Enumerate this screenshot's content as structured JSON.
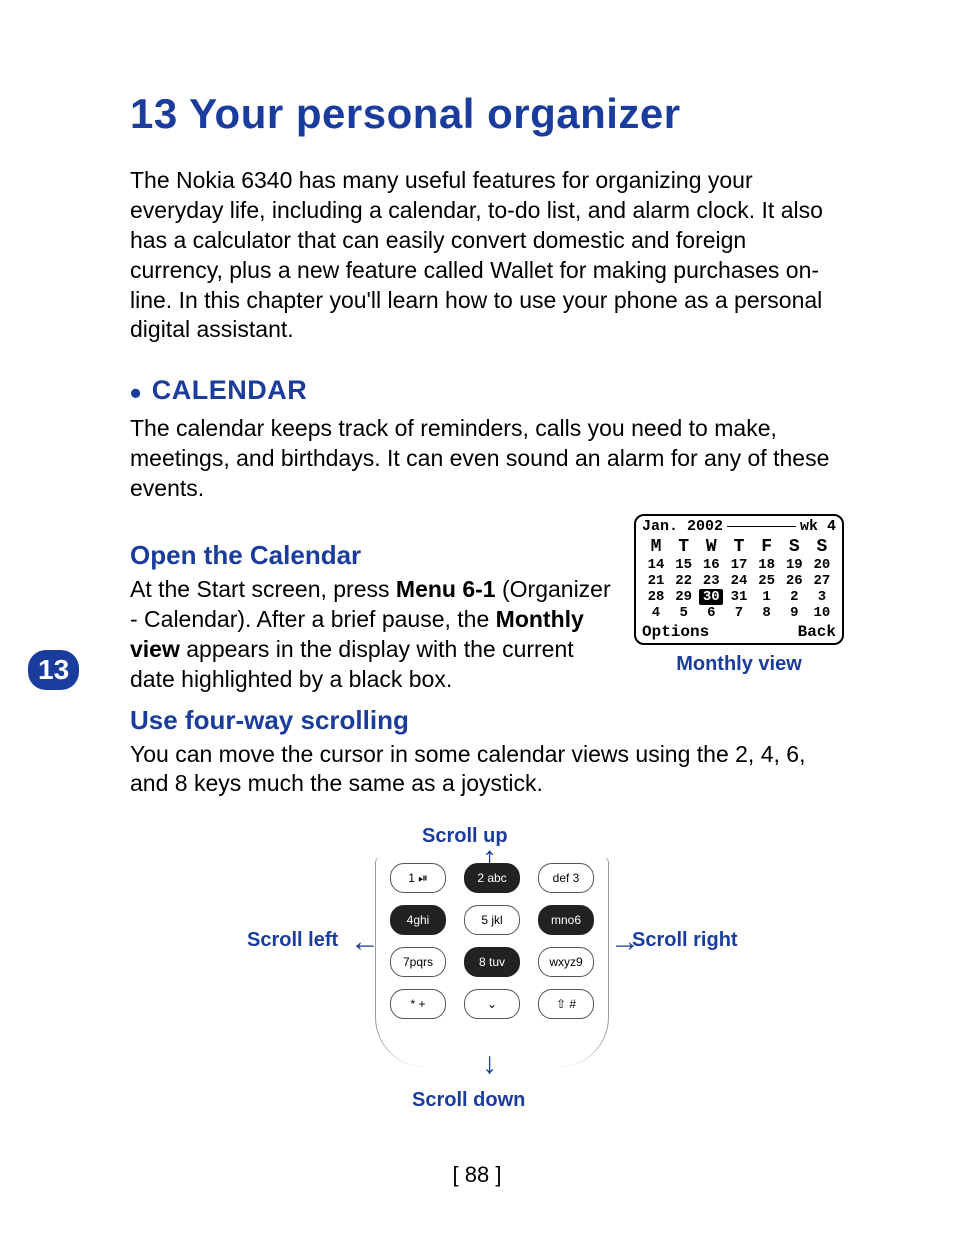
{
  "chapter": {
    "number": "13",
    "title": "Your personal organizer",
    "tab": "13"
  },
  "intro": "The Nokia 6340 has many useful features for organizing your everyday life, including a calendar, to-do list, and alarm clock. It also has a calculator that can easily convert domestic and foreign currency, plus a new feature called Wallet for making purchases on-line. In this chapter you'll learn how to use your phone as a personal digital assistant.",
  "section": {
    "heading": "CALENDAR",
    "text": "The calendar keeps track of reminders, calls you need to make, meetings, and birthdays. It can even sound an alarm for any of these events."
  },
  "open": {
    "heading": "Open the Calendar",
    "pre": "At the Start screen, press ",
    "menu": "Menu 6-1",
    "mid": " (Organizer - Calendar). After a brief pause, the ",
    "monthly": "Monthly view",
    "post": " appears in the display with the current date highlighted by a black box."
  },
  "calendar": {
    "month": "Jan. 2002",
    "week": "wk 4",
    "days": [
      "M",
      "T",
      "W",
      "T",
      "F",
      "S",
      "S"
    ],
    "rows": [
      [
        "14",
        "15",
        "16",
        "17",
        "18",
        "19",
        "20"
      ],
      [
        "21",
        "22",
        "23",
        "24",
        "25",
        "26",
        "27"
      ],
      [
        "28",
        "29",
        "30",
        "31",
        "1",
        "2",
        "3"
      ],
      [
        "4",
        "5",
        "6",
        "7",
        "8",
        "9",
        "10"
      ]
    ],
    "selected": "30",
    "left": "Options",
    "right": "Back",
    "caption": "Monthly view"
  },
  "scroll": {
    "heading": "Use four-way scrolling",
    "text": "You can move the cursor in some calendar views using the 2, 4, 6, and 8 keys much the same as a joystick.",
    "up": "Scroll up",
    "down": "Scroll down",
    "left": "Scroll left",
    "right": "Scroll right",
    "keys": {
      "r1": [
        "1 ⏯",
        "2 abc",
        "def 3"
      ],
      "r2": [
        "4ghi",
        "5 jkl",
        "mno6"
      ],
      "r3": [
        "7pqrs",
        "8 tuv",
        "wxyz9"
      ],
      "r4": [
        "* +",
        "⌄",
        "⇧ #"
      ]
    }
  },
  "pagenum": "[ 88 ]"
}
